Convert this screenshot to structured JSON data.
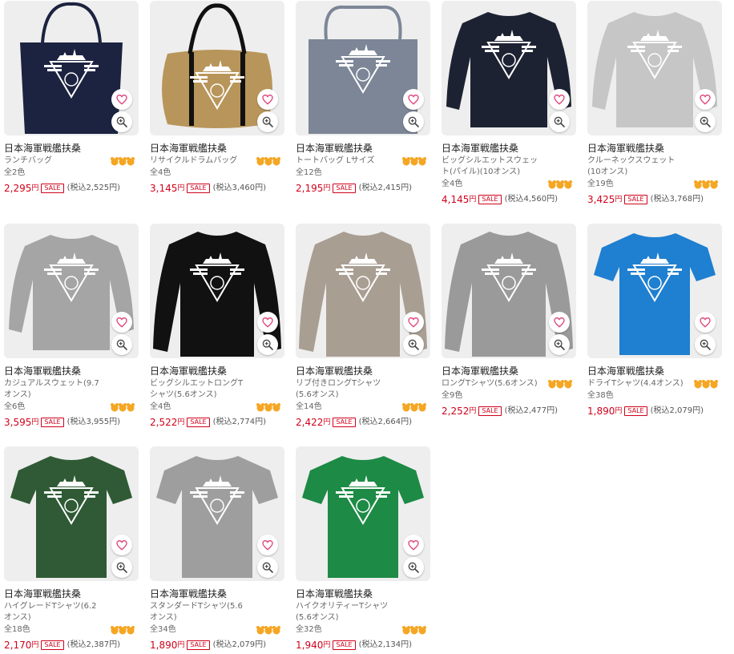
{
  "product_title": "日本海軍戦艦扶桑",
  "currency_suffix": "円",
  "sale_badge": "SALE",
  "colors": {
    "price_red": "#d0021b",
    "thumb_bg": "#eeeeee",
    "heart_pink": "#e0407a",
    "bear_gold": "#f5a623"
  },
  "products": [
    {
      "subtitle": "ランチバッグ",
      "colors": "全2色",
      "price": "2,295",
      "tax_in": "(税込2,525円)",
      "item": "tote-small",
      "color": "#1c2340"
    },
    {
      "subtitle": "リサイクルドラムバッグ",
      "colors": "全4色",
      "price": "3,145",
      "tax_in": "(税込3,460円)",
      "item": "drum-bag",
      "color": "#b8955a"
    },
    {
      "subtitle": "トートバッグ Lサイズ",
      "colors": "全12色",
      "price": "2,195",
      "tax_in": "(税込2,415円)",
      "item": "tote-large",
      "color": "#7c8697"
    },
    {
      "subtitle": "ビッグシルエットスウェット(パイル)(10オンス)",
      "colors": "全4色",
      "price": "4,145",
      "tax_in": "(税込4,560円)",
      "item": "sweat",
      "color": "#1d2233"
    },
    {
      "subtitle": "クルーネックスウェット(10オンス)",
      "colors": "全19色",
      "price": "3,425",
      "tax_in": "(税込3,768円)",
      "item": "sweat",
      "color": "#c6c6c6"
    },
    {
      "subtitle": "カジュアルスウェット(9.7オンス)",
      "colors": "全6色",
      "price": "3,595",
      "tax_in": "(税込3,955円)",
      "item": "sweat",
      "color": "#a5a5a5"
    },
    {
      "subtitle": "ビッグシルエットロングTシャツ(5.6オンス)",
      "colors": "全4色",
      "price": "2,522",
      "tax_in": "(税込2,774円)",
      "item": "longsleeve",
      "color": "#111111"
    },
    {
      "subtitle": "リブ付きロングTシャツ(5.6オンス)",
      "colors": "全14色",
      "price": "2,422",
      "tax_in": "(税込2,664円)",
      "item": "longsleeve",
      "color": "#a99e92"
    },
    {
      "subtitle": "ロングTシャツ(5.6オンス)",
      "colors": "全9色",
      "price": "2,252",
      "tax_in": "(税込2,477円)",
      "item": "longsleeve",
      "color": "#9a9a9a"
    },
    {
      "subtitle": "ドライTシャツ(4.4オンス)",
      "colors": "全38色",
      "price": "1,890",
      "tax_in": "(税込2,079円)",
      "item": "tshirt",
      "color": "#1f7fd0"
    },
    {
      "subtitle": "ハイグレードTシャツ(6.2オンス)",
      "colors": "全18色",
      "price": "2,170",
      "tax_in": "(税込2,387円)",
      "item": "tshirt",
      "color": "#2f5a35"
    },
    {
      "subtitle": "スタンダードTシャツ(5.6オンス)",
      "colors": "全34色",
      "price": "1,890",
      "tax_in": "(税込2,079円)",
      "item": "tshirt",
      "color": "#9e9e9e"
    },
    {
      "subtitle": "ハイクオリティーTシャツ(5.6オンス)",
      "colors": "全32色",
      "price": "1,940",
      "tax_in": "(税込2,134円)",
      "item": "tshirt",
      "color": "#1d8a45"
    }
  ]
}
